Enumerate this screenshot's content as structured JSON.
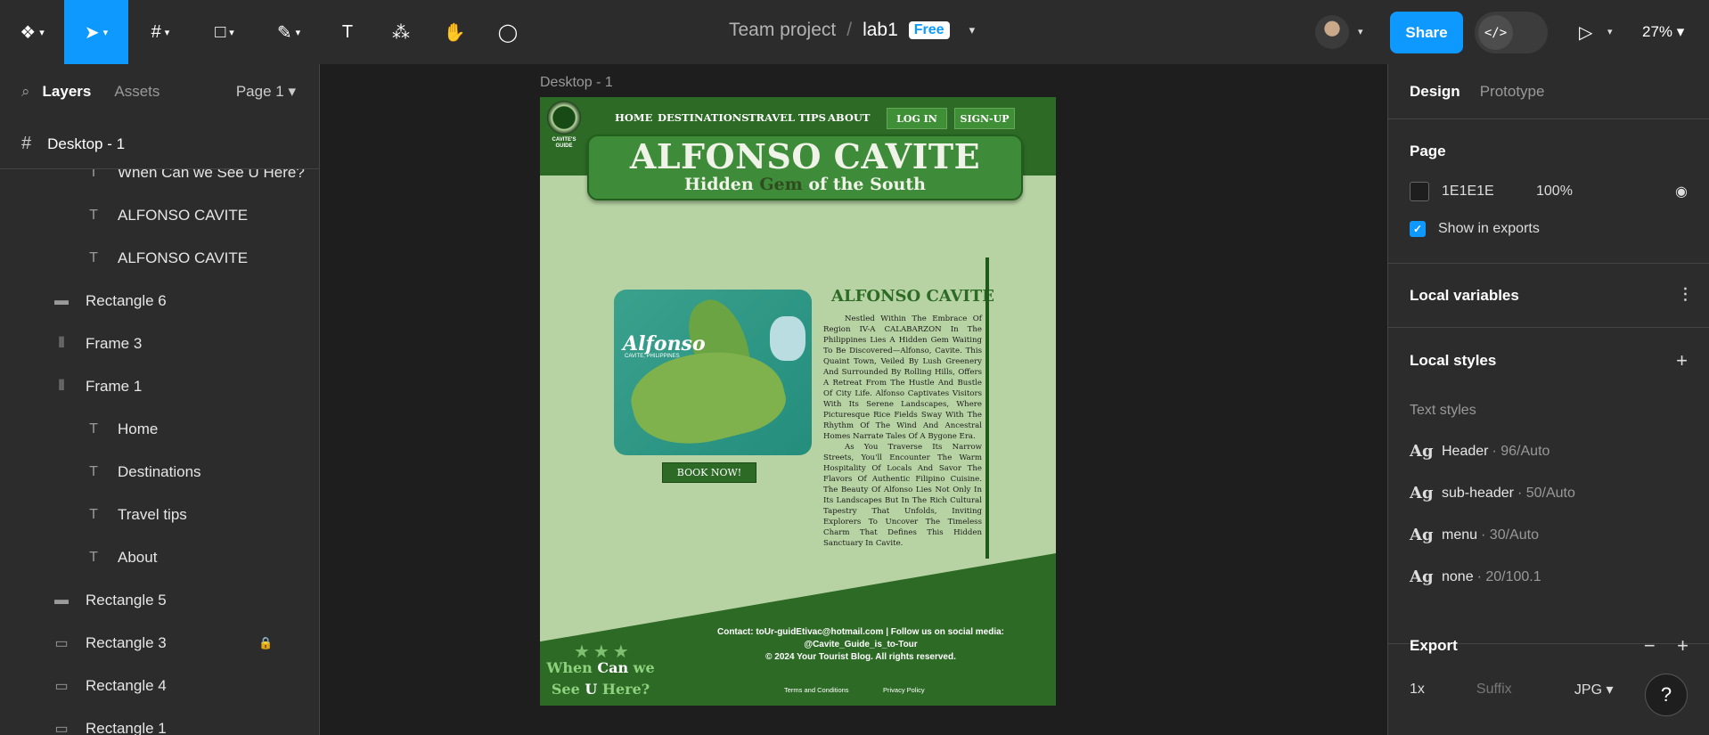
{
  "toolbar": {
    "project_team": "Team project",
    "project_sep": "/",
    "file_name": "lab1",
    "plan_badge": "Free",
    "share_label": "Share",
    "zoom_level": "27%"
  },
  "left_panel": {
    "tab_layers": "Layers",
    "tab_assets": "Assets",
    "page_selector": "Page 1",
    "frame_name": "Desktop - 1",
    "layers": [
      {
        "type": "text",
        "name": "When Can we See U Here?"
      },
      {
        "type": "text",
        "name": "ALFONSO CAVITE"
      },
      {
        "type": "text",
        "name": "ALFONSO CAVITE"
      },
      {
        "type": "rect",
        "name": "Rectangle 6"
      },
      {
        "type": "frame",
        "name": "Frame 3"
      },
      {
        "type": "frame",
        "name": "Frame 1"
      },
      {
        "type": "text",
        "name": "Home"
      },
      {
        "type": "text",
        "name": "Destinations"
      },
      {
        "type": "text",
        "name": "Travel tips"
      },
      {
        "type": "text",
        "name": "About"
      },
      {
        "type": "rect",
        "name": "Rectangle 5"
      },
      {
        "type": "rect",
        "name": "Rectangle 3",
        "locked": true
      },
      {
        "type": "rect",
        "name": "Rectangle 4"
      },
      {
        "type": "rect",
        "name": "Rectangle 1"
      }
    ]
  },
  "canvas": {
    "frame_label": "Desktop - 1",
    "site": {
      "logo_text": "CAVITE'S GUIDE",
      "nav": [
        "HOME",
        "DESTINATIONS",
        "TRAVEL TIPS",
        "ABOUT"
      ],
      "login_label": "LOG IN",
      "signup_label": "SIGN-UP",
      "title": "ALFONSO CAVITE",
      "subtitle_pre": "Hidden",
      "subtitle_gem": "Gem",
      "subtitle_post": "of the South",
      "map_name": "Alfonso",
      "map_sub": "CAVITE, PHILIPPINES",
      "book_label": "BOOK NOW!",
      "section_title": "ALFONSO CAVITE",
      "paragraph1": "Nestled Within The Embrace Of Region IV-A CALABARZON In The Philippines Lies A Hidden Gem Waiting To Be Discovered—Alfonso, Cavite. This Quaint Town, Veiled By Lush Greenery And Surrounded By Rolling Hills, Offers A Retreat From The Hustle And Bustle Of City Life. Alfonso Captivates Visitors With Its Serene Landscapes, Where Picturesque Rice Fields Sway With The Rhythm Of The Wind And Ancestral Homes Narrate Tales Of A Bygone Era.",
      "paragraph2": "As You Traverse Its Narrow Streets, You'll Encounter The Warm Hospitality Of Locals And Savor The Flavors Of Authentic Filipino Cuisine. The Beauty Of Alfonso Lies Not Only In Its Landscapes But In The Rich Cultural Tapestry That Unfolds, Inviting Explorers To Uncover The Timeless Charm That Defines This Hidden Sanctuary In Cavite.",
      "contact_line1": "Contact: toUr-guidEtivac@hotmail.com | Follow us on social media:",
      "contact_line2": "@Cavite_Guide_is_to-Tour",
      "contact_line3": "© 2024 Your Tourist Blog. All rights reserved.",
      "terms_label": "Terms and Conditions",
      "privacy_label": "Privacy Policy",
      "stars": "★★★",
      "when_1": "When",
      "when_2": "Can",
      "when_3": "we",
      "when_4": "See",
      "when_5": "U",
      "when_6": "Here?"
    }
  },
  "right_panel": {
    "tab_design": "Design",
    "tab_prototype": "Prototype",
    "page_title": "Page",
    "page_fill_hex": "1E1E1E",
    "page_fill_opacity": "100%",
    "show_in_exports": "Show in exports",
    "local_variables": "Local variables",
    "local_styles": "Local styles",
    "text_styles_label": "Text styles",
    "text_styles": [
      {
        "name": "Header",
        "meta": "· 96/Auto"
      },
      {
        "name": "sub-header",
        "meta": "· 50/Auto"
      },
      {
        "name": "menu",
        "meta": "· 30/Auto"
      },
      {
        "name": "none",
        "meta": "· 20/100.1"
      }
    ],
    "export_title": "Export",
    "export_scale": "1x",
    "export_suffix_placeholder": "Suffix",
    "export_format": "JPG"
  },
  "colors": {
    "accent": "#0d99ff",
    "site_green": "#2d6a26",
    "site_bg": "#b7d3a3"
  }
}
